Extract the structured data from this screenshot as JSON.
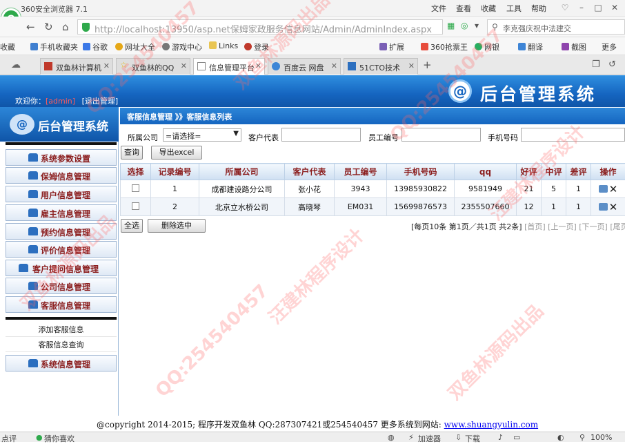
{
  "browser": {
    "title": "360安全浏览器 7.1",
    "menu": [
      "文件",
      "查看",
      "收藏",
      "工具",
      "帮助"
    ],
    "url": "http://localhost:13950/asp.net保姆家政服务信息网站/Admin/AdminIndex.aspx",
    "search": "李克强庆祝中法建交",
    "bookmarks": [
      "收藏",
      "手机收藏夹",
      "谷歌",
      "网址大全",
      "游戏中心",
      "Links",
      "登录",
      "扩展",
      "360抢票王",
      "网银",
      "翻译",
      "截图",
      "更多"
    ],
    "tabs": [
      "双鱼林计算机",
      "双鱼林的QQ",
      "信息管理平台",
      "百度云 网盘",
      "51CTO技术"
    ]
  },
  "header": {
    "welcome": "欢迎你：",
    "admin": "[admin]",
    "logout": "[退出管理]",
    "system": "后台管理系统"
  },
  "sidebar": {
    "title": "后台管理系统",
    "items": [
      "系统参数设置",
      "保姆信息管理",
      "用户信息管理",
      "雇主信息管理",
      "预约信息管理",
      "评价信息管理",
      "客户提问信息管理",
      "公司信息管理",
      "客服信息管理"
    ],
    "sub": [
      "添加客服信息",
      "客服信息查询"
    ],
    "last": "系统信息管理"
  },
  "main": {
    "breadcrumb": "客服信息管理 》》客服信息列表",
    "filters": {
      "company_label": "所属公司",
      "company_value": "=请选择=",
      "rep_label": "客户代表",
      "empno_label": "员工编号",
      "phone_label": "手机号码"
    },
    "query_btn": "查询",
    "export_btn": "导出excel",
    "columns": [
      "选择",
      "记录编号",
      "所属公司",
      "客户代表",
      "员工编号",
      "手机号码",
      "qq",
      "好评",
      "中评",
      "差评",
      "操作"
    ],
    "rows": [
      {
        "id": "1",
        "company": "成都建设路分公司",
        "rep": "张小花",
        "emp": "3943",
        "phone": "13985930822",
        "qq": "9581949",
        "good": "21",
        "mid": "5",
        "bad": "1"
      },
      {
        "id": "2",
        "company": "北京立水桥公司",
        "rep": "高晓琴",
        "emp": "EM031",
        "phone": "15699876573",
        "qq": "2355507660",
        "good": "12",
        "mid": "1",
        "bad": "1"
      }
    ],
    "select_all": "全选",
    "delete_sel": "删除选中",
    "pager": {
      "info": "[每页10条 第1页／共1页 共2条]",
      "first": "[首页]",
      "prev": "[上一页]",
      "next": "[下一页]",
      "last": "[尾页"
    }
  },
  "footer": {
    "copyright": "@copyright 2014-2015; 程序开发双鱼林 QQ:287307421或254540457 更多系统到网站: ",
    "site": "www.shuangyulin.com"
  },
  "status": {
    "left1": "点评",
    "left2": "猜你喜欢",
    "accel": "加速器",
    "download": "下载",
    "zoom": "100%"
  },
  "watermarks": [
    "双鱼林源码出品",
    "QQ:254540457",
    "汪建林程序设计"
  ]
}
